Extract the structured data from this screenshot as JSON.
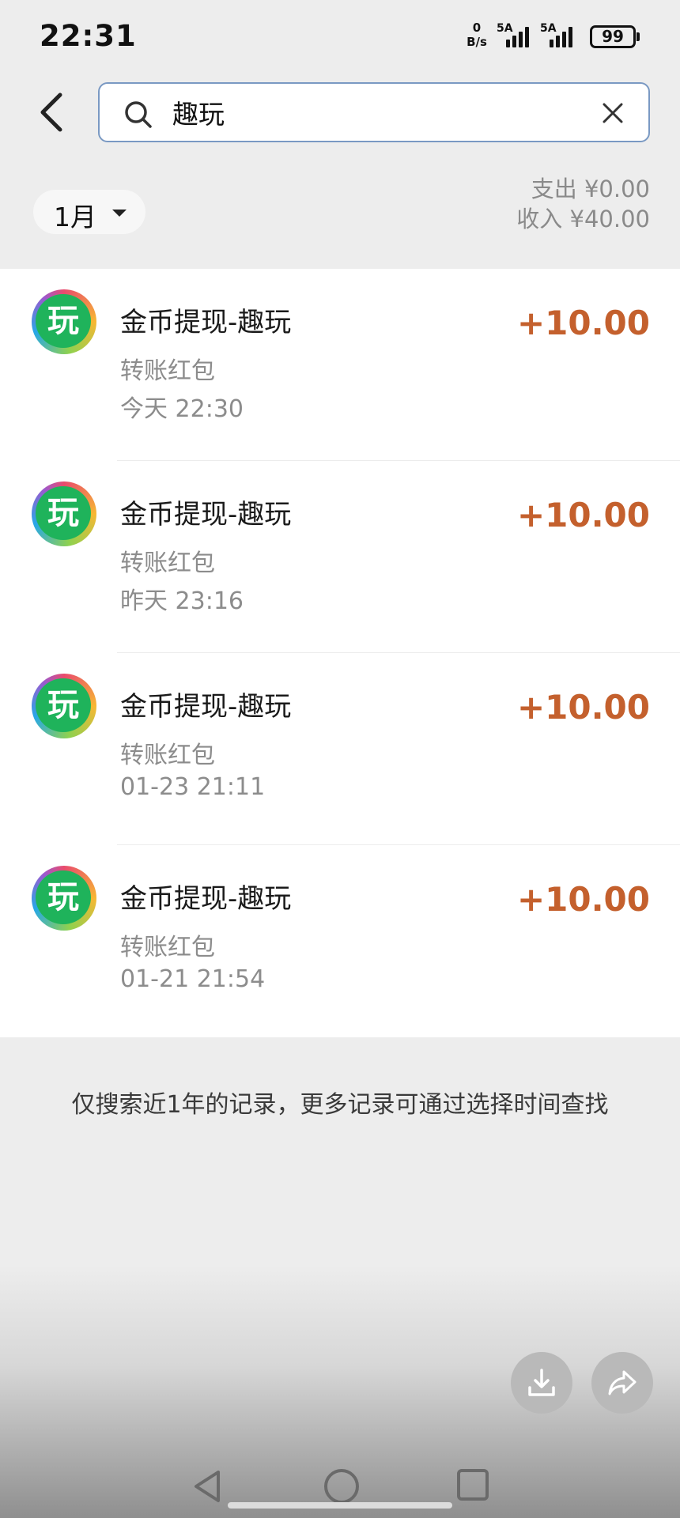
{
  "status_bar": {
    "time": "22:31",
    "net_speed_value": "0",
    "net_speed_unit": "B/s",
    "signal_1_tag": "5A",
    "signal_2_tag": "5A",
    "battery": "99"
  },
  "search": {
    "query": "趣玩"
  },
  "filter": {
    "month": "1月"
  },
  "summary": {
    "expense": "支出 ¥0.00",
    "income": "收入 ¥40.00"
  },
  "records": [
    {
      "logo_text": "玩",
      "title": "金币提现-趣玩",
      "type": "转账红包",
      "time": "今天 22:30",
      "amount": "+10.00"
    },
    {
      "logo_text": "玩",
      "title": "金币提现-趣玩",
      "type": "转账红包",
      "time": "昨天 23:16",
      "amount": "+10.00"
    },
    {
      "logo_text": "玩",
      "title": "金币提现-趣玩",
      "type": "转账红包",
      "time": "01-23 21:11",
      "amount": "+10.00"
    },
    {
      "logo_text": "玩",
      "title": "金币提现-趣玩",
      "type": "转账红包",
      "time": "01-21 21:54",
      "amount": "+10.00"
    }
  ],
  "footnote": "仅搜索近1年的记录，更多记录可通过选择时间查找",
  "icons": {
    "back": "chevron-left-icon",
    "search": "search-icon",
    "clear": "close-icon",
    "month_caret": "caret-down-icon",
    "download": "download-icon",
    "share": "share-icon"
  },
  "colors": {
    "amount": "#c4602d",
    "search_border": "#7a99c3",
    "logo_green": "#1fb35b"
  }
}
